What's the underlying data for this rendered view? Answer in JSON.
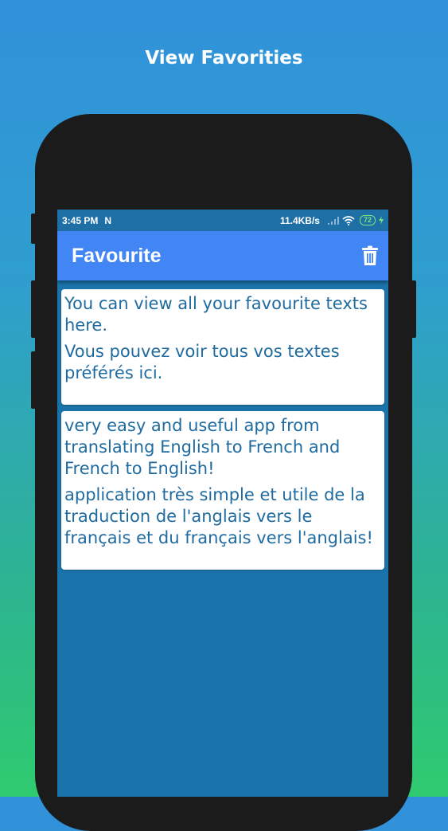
{
  "promo": {
    "title": "View Favorities"
  },
  "status_bar": {
    "time": "3:45 PM",
    "notification_letter": "N",
    "speed": "11.4KB/s",
    "battery": "72"
  },
  "appbar": {
    "title": "Favourite",
    "delete_icon": "trash-icon"
  },
  "favorites": [
    {
      "english": "You can view all your favourite texts here.",
      "french": "Vous pouvez voir tous vos textes préférés ici."
    },
    {
      "english": "very easy and useful app from translating English to French and French to English!",
      "french": "application très simple et utile de la traduction de l'anglais vers le français et du français vers l'anglais!"
    }
  ],
  "colors": {
    "appbar": "#4285f4",
    "screen_background": "#1a74ab",
    "text": "#1f6ba0"
  }
}
